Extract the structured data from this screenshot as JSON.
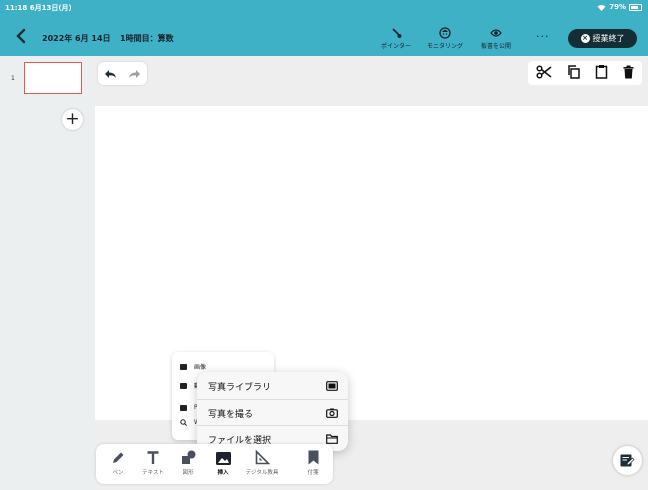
{
  "status": {
    "time": "11:18",
    "date": "6月13日(月)",
    "battery_text": "79%"
  },
  "header": {
    "lesson_date": "2022年 6月 14日",
    "lesson_title": "1時間目：算数",
    "tools": [
      {
        "label": "ポインター",
        "icon": "pointer-icon"
      },
      {
        "label": "モニタリング",
        "icon": "monitor-face-icon"
      },
      {
        "label": "板書を公開",
        "icon": "eye-icon"
      }
    ],
    "more_label": "···",
    "end_label": "授業終了",
    "colors": {
      "header_bg": "#3fb1c7",
      "end_button_bg": "#142e36",
      "thumb_border": "#e35a53"
    }
  },
  "sidebar": {
    "pages": [
      {
        "number": "1"
      }
    ],
    "add_label": "+"
  },
  "insert_menu": {
    "items": [
      {
        "label": "画像",
        "icon": "image-icon"
      },
      {
        "label": "動",
        "icon": "video-icon"
      },
      {
        "label": "P",
        "icon": "pdf-icon"
      },
      {
        "label": "W",
        "icon": "search-icon"
      }
    ]
  },
  "popup": {
    "items": [
      {
        "label": "写真ライブラリ",
        "icon": "photo-library-icon"
      },
      {
        "label": "写真を撮る",
        "icon": "camera-icon"
      },
      {
        "label": "ファイルを選択",
        "icon": "folder-icon"
      }
    ]
  },
  "toolbar": {
    "items": [
      {
        "label": "ペン",
        "icon": "pen-icon"
      },
      {
        "label": "テキスト",
        "icon": "text-icon"
      },
      {
        "label": "図形",
        "icon": "shapes-icon"
      },
      {
        "label": "挿入",
        "icon": "insert-image-icon",
        "active": true
      },
      {
        "label": "デジタル教具",
        "icon": "ruler-triangle-icon"
      },
      {
        "label": "付箋",
        "icon": "bookmark-icon"
      }
    ]
  }
}
